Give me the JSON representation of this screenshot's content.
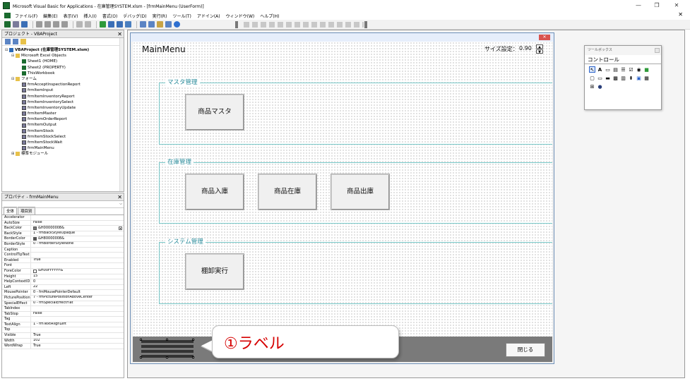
{
  "window": {
    "title": "Microsoft Visual Basic for Applications - 在庫管理SYSTEM.xlsm - [frmMainMenu (UserForm)]",
    "minimize": "—",
    "restore": "❐",
    "close": "✕"
  },
  "menu": {
    "items": [
      "ファイル(F)",
      "編集(E)",
      "表示(V)",
      "挿入(I)",
      "書式(O)",
      "デバッグ(D)",
      "実行(R)",
      "ツール(T)",
      "アドイン(A)",
      "ウィンドウ(W)",
      "ヘルプ(H)"
    ],
    "close": "✕"
  },
  "project": {
    "title": "プロジェクト - VBAProject",
    "close": "✕",
    "tree": [
      {
        "label": "VBAProject (在庫管理SYSTEM.xlsm)",
        "indent": 0,
        "icon": "proj",
        "exp": "⊟",
        "bold": true
      },
      {
        "label": "Microsoft Excel Objects",
        "indent": 1,
        "icon": "folder",
        "exp": "⊟"
      },
      {
        "label": "Sheet1 (HOME)",
        "indent": 2,
        "icon": "sheet",
        "exp": ""
      },
      {
        "label": "Sheet2 (PROPERTY)",
        "indent": 2,
        "icon": "sheet",
        "exp": ""
      },
      {
        "label": "ThisWorkbook",
        "indent": 2,
        "icon": "sheet",
        "exp": ""
      },
      {
        "label": "フォーム",
        "indent": 1,
        "icon": "folder",
        "exp": "⊟"
      },
      {
        "label": "frmAcceptInspectionReport",
        "indent": 2,
        "icon": "form",
        "exp": ""
      },
      {
        "label": "frmItemInput",
        "indent": 2,
        "icon": "form",
        "exp": ""
      },
      {
        "label": "frmItemInventoryReport",
        "indent": 2,
        "icon": "form",
        "exp": ""
      },
      {
        "label": "frmItemInventorySelect",
        "indent": 2,
        "icon": "form",
        "exp": ""
      },
      {
        "label": "frmItemInventoryUpdate",
        "indent": 2,
        "icon": "form",
        "exp": ""
      },
      {
        "label": "frmItemMaster",
        "indent": 2,
        "icon": "form",
        "exp": ""
      },
      {
        "label": "frmItemOrderReport",
        "indent": 2,
        "icon": "form",
        "exp": ""
      },
      {
        "label": "frmItemOutput",
        "indent": 2,
        "icon": "form",
        "exp": ""
      },
      {
        "label": "frmItemStock",
        "indent": 2,
        "icon": "form",
        "exp": ""
      },
      {
        "label": "frmItemStockSelect",
        "indent": 2,
        "icon": "form",
        "exp": ""
      },
      {
        "label": "frmItemStockWait",
        "indent": 2,
        "icon": "form",
        "exp": ""
      },
      {
        "label": "frmMainMenu",
        "indent": 2,
        "icon": "form",
        "exp": ""
      },
      {
        "label": "標準モジュール",
        "indent": 1,
        "icon": "folder",
        "exp": "⊞"
      }
    ]
  },
  "properties": {
    "title": "プロパティ - frmMainMenu",
    "close": "✕",
    "tabs": [
      "全体",
      "項目別"
    ],
    "rows": [
      {
        "name": "Accelerator",
        "value": ""
      },
      {
        "name": "AutoSize",
        "value": "False"
      },
      {
        "name": "BackColor",
        "value": "&H00000008&",
        "swatch": "#7a7a7a",
        "selected": true
      },
      {
        "name": "BackStyle",
        "value": "1 - fmBackStyleOpaque"
      },
      {
        "name": "BorderColor",
        "value": "&H80000008&",
        "swatch": "#555555"
      },
      {
        "name": "BorderStyle",
        "value": "0 - fmBorderStyleNone"
      },
      {
        "name": "Caption",
        "value": ""
      },
      {
        "name": "ControlTipText",
        "value": ""
      },
      {
        "name": "Enabled",
        "value": "True"
      },
      {
        "name": "Font",
        "value": ""
      },
      {
        "name": "ForeColor",
        "value": "&H00FFFFFF&",
        "swatch": "#ffffff"
      },
      {
        "name": "Height",
        "value": "15"
      },
      {
        "name": "HelpContextID",
        "value": "0"
      },
      {
        "name": "Left",
        "value": "22"
      },
      {
        "name": "MousePointer",
        "value": "0 - fmMousePointerDefault"
      },
      {
        "name": "PicturePosition",
        "value": "7 - fmPicturePositionAboveCenter"
      },
      {
        "name": "SpecialEffect",
        "value": "0 - fmSpecialEffectFlat"
      },
      {
        "name": "TabIndex",
        "value": ""
      },
      {
        "name": "TabStop",
        "value": "False"
      },
      {
        "name": "Tag",
        "value": ""
      },
      {
        "name": "TextAlign",
        "value": "1 - fmTextAlignLeft"
      },
      {
        "name": "Top",
        "value": ""
      },
      {
        "name": "Visible",
        "value": "True"
      },
      {
        "name": "Width",
        "value": "102"
      },
      {
        "name": "WordWrap",
        "value": "True"
      }
    ]
  },
  "form": {
    "close": "✕",
    "title": "MainMenu",
    "size_label": "サイズ設定：",
    "size_value": "0.90",
    "spin_up": "▲",
    "spin_down": "▼",
    "frames": {
      "master": {
        "label": "マスタ管理",
        "buttons": [
          "商品マスタ"
        ]
      },
      "stock": {
        "label": "在庫管理",
        "buttons": [
          "商品入庫",
          "商品在庫",
          "商品出庫"
        ]
      },
      "system": {
        "label": "システム管理",
        "buttons": [
          "棚卸実行"
        ]
      }
    },
    "close_button": "閉じる"
  },
  "callout": {
    "text": "①ラベル"
  },
  "toolbox": {
    "title": "ツールボックス",
    "tab": "コントロール"
  }
}
